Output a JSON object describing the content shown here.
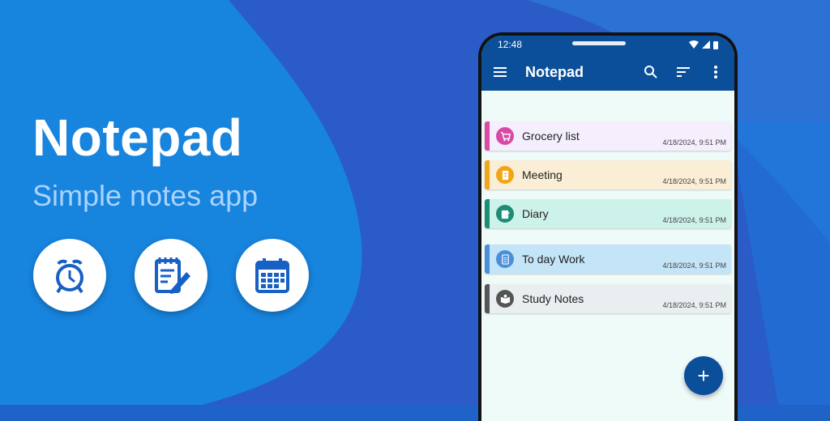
{
  "colors": {
    "background": "#1f63c9",
    "accent": "#0b4f9a",
    "subtitle": "#a9d3ff"
  },
  "promo": {
    "title": "Notepad",
    "subtitle": "Simple notes app",
    "features": [
      {
        "icon": "alarm-clock-icon"
      },
      {
        "icon": "notepad-edit-icon"
      },
      {
        "icon": "calendar-icon"
      }
    ]
  },
  "phone": {
    "status_time": "12:48",
    "app_title": "Notepad",
    "actions": [
      "search-icon",
      "sort-icon",
      "more-vert-icon"
    ],
    "fab_label": "+",
    "notes": [
      {
        "title": "Grocery list",
        "time": "4/18/2024, 9:51 PM",
        "color": "#d94aa4",
        "bg": "#f5eefd",
        "icon": "cart-icon"
      },
      {
        "title": "Meeting",
        "time": "4/18/2024, 9:51 PM",
        "color": "#f2a516",
        "bg": "#fbeed6",
        "icon": "document-icon"
      },
      {
        "title": "Diary",
        "time": "4/18/2024, 9:51 PM",
        "color": "#1d8c74",
        "bg": "#cdf2ea",
        "icon": "diary-icon"
      },
      {
        "title": "To day Work",
        "time": "4/18/2024, 9:51 PM",
        "color": "#4a8fd8",
        "bg": "#c4e4f7",
        "icon": "page-icon"
      },
      {
        "title": "Study Notes",
        "time": "4/18/2024, 9:51 PM",
        "color": "#555555",
        "bg": "#e9eef1",
        "icon": "book-icon"
      }
    ]
  }
}
